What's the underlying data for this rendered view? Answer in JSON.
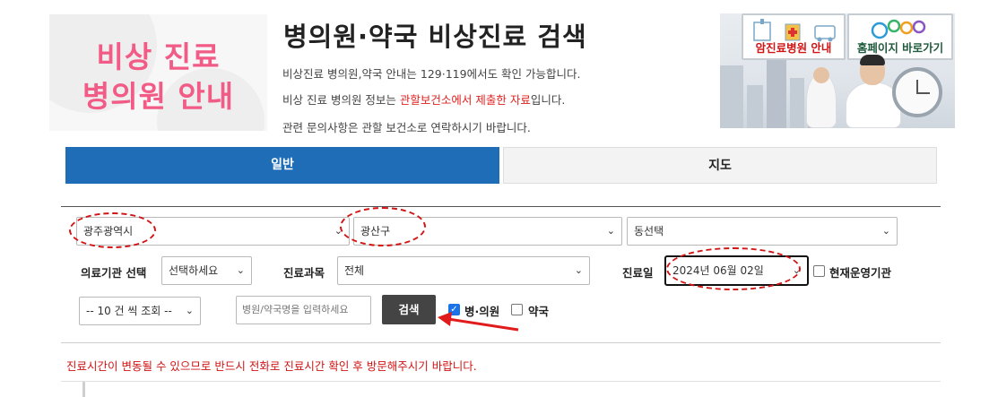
{
  "hero": {
    "line1": "비상 진료",
    "line2": "병의원 안내"
  },
  "header": {
    "title": "병의원·약국 비상진료 검색",
    "info1": "비상진료 병의원,약국 안내는 129·119에서도 확인 가능합니다.",
    "info2_pre": "비상 진료 병의원 정보는 ",
    "info2_red": "관할보건소에서 제출한 자료",
    "info2_post": "입니다.",
    "info3": "관련 문의사항은 관할 보건소로 연락하시기 바랍니다."
  },
  "banner": {
    "hospital_label": "암진료병원 안내",
    "homepage_label": "홈페이지 바로가기"
  },
  "tabs": {
    "general": "일반",
    "map": "지도"
  },
  "filters": {
    "city": "광주광역시",
    "district": "광산구",
    "dong": "동선택",
    "institution_label": "의료기관 선택",
    "institution_value": "선택하세요",
    "subject_label": "진료과목",
    "subject_value": "전체",
    "date_label": "진료일",
    "date_value": "2024년 06월 02일",
    "current_label": "현재운영기관",
    "page_size": "-- 10 건 씩 조회 --",
    "search_placeholder": "병원/약국명을 입력하세요",
    "search_button": "검색",
    "hospital_check": "병·의원",
    "pharmacy_check": "약국"
  },
  "notice": "진료시간이 변동될 수 있으므로 반드시 전화로 진료시간 확인 후 방문해주시기 바랍니다.",
  "colors": {
    "accent_blue": "#1f6db7",
    "hero_pink": "#f15b86",
    "warning_red": "#d11414"
  }
}
